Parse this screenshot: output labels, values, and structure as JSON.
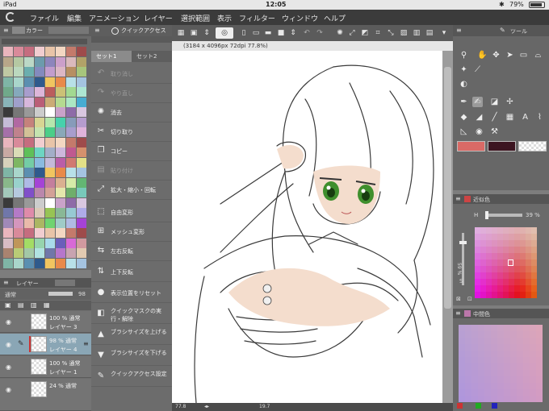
{
  "status": {
    "device": "iPad",
    "time": "12:05",
    "battery": "79%"
  },
  "menu": [
    "ファイル",
    "編集",
    "アニメーション",
    "レイヤー",
    "選択範囲",
    "表示",
    "フィルター",
    "ウィンドウ",
    "ヘルプ"
  ],
  "color_panel": {
    "title": "カラー"
  },
  "quick_access": {
    "title": "クイックアクセス",
    "tabs": [
      "セット1",
      "セット2"
    ],
    "items": [
      {
        "label": "取り消し",
        "icon": "undo-icon",
        "enabled": false
      },
      {
        "label": "やり直し",
        "icon": "redo-icon",
        "enabled": false
      },
      {
        "label": "消去",
        "icon": "clear-icon",
        "enabled": true
      },
      {
        "label": "切り取り",
        "icon": "scissors-icon",
        "enabled": true
      },
      {
        "label": "コピー",
        "icon": "copy-icon",
        "enabled": true
      },
      {
        "label": "貼り付け",
        "icon": "paste-icon",
        "enabled": false
      },
      {
        "label": "拡大・縮小・回転",
        "icon": "transform-icon",
        "enabled": true
      },
      {
        "label": "自由変形",
        "icon": "free-transform-icon",
        "enabled": true
      },
      {
        "label": "メッシュ変形",
        "icon": "mesh-transform-icon",
        "enabled": true
      },
      {
        "label": "左右反転",
        "icon": "flip-horizontal-icon",
        "enabled": true
      },
      {
        "label": "上下反転",
        "icon": "flip-vertical-icon",
        "enabled": true
      },
      {
        "label": "表示位置をリセット",
        "icon": "reset-view-icon",
        "enabled": true
      },
      {
        "label": "クイックマスクの実行・解除",
        "icon": "quick-mask-icon",
        "enabled": true
      },
      {
        "label": "ブラシサイズを上げる",
        "icon": "brush-size-up-icon",
        "enabled": true
      },
      {
        "label": "ブラシサイズを下げる",
        "icon": "brush-size-down-icon",
        "enabled": true
      },
      {
        "label": "クイックアクセス設定",
        "icon": "quick-access-settings-icon",
        "enabled": true
      }
    ]
  },
  "layer_panel": {
    "title": "レイヤー",
    "blend": "通常",
    "opacity": "98",
    "layers": [
      {
        "line1": "100 % 通常",
        "line2": "レイヤー 3",
        "selected": false
      },
      {
        "line1": "98 % 通常",
        "line2": "レイヤー 4",
        "selected": true
      },
      {
        "line1": "100 % 通常",
        "line2": "レイヤー 1",
        "selected": false
      },
      {
        "line1": "24 % 通常",
        "line2": "",
        "selected": false
      }
    ]
  },
  "document": {
    "title": "(3184 x 4096px 72dpi 77.8%)",
    "zoom": "77.8",
    "angle": "19.7"
  },
  "tool_panel": {
    "title": "ツール",
    "main_color": "#d96a66",
    "sub_color": "#3c1521"
  },
  "near_color": {
    "title": "近似色",
    "h_label": "H",
    "h_value": "39 %",
    "s_label": "S",
    "s_value": "59 %"
  },
  "mid_color": {
    "title": "中間色"
  }
}
